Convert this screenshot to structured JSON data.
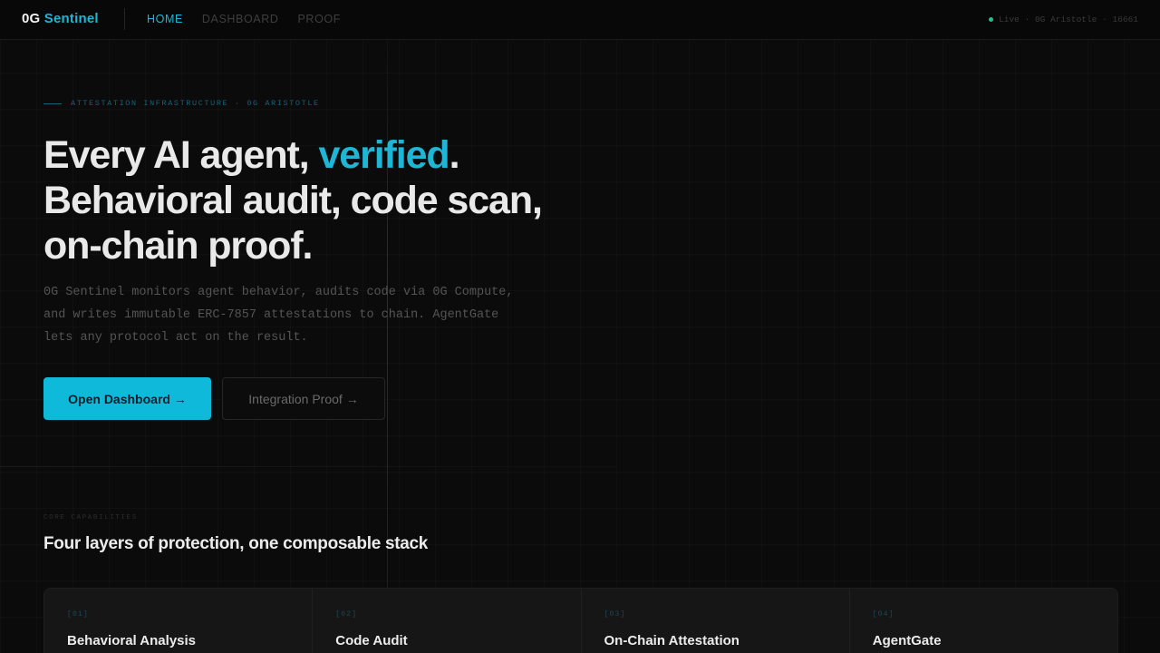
{
  "nav": {
    "brand_prefix": "0G",
    "brand_name": "Sentinel",
    "links": [
      {
        "label": "HOME"
      },
      {
        "label": "DASHBOARD"
      },
      {
        "label": "PROOF"
      }
    ],
    "status": "Live · 0G Aristotle · 16661"
  },
  "hero": {
    "eyebrow": "ATTESTATION INFRASTRUCTURE · 0G ARISTOTLE",
    "headline_line1_before": "Every AI agent, ",
    "headline_highlight": "verified",
    "headline_line1_after": ".",
    "headline_line2": "Behavioral audit, code scan,",
    "headline_line3": "on-chain proof.",
    "description": "0G Sentinel monitors agent behavior, audits code via 0G Compute, and writes immutable ERC-7857 attestations to chain. AgentGate lets any protocol act on the result.",
    "primary_button": "Open Dashboard →",
    "secondary_button": "Integration Proof →"
  },
  "capabilities": {
    "eyebrow": "CORE CAPABILITIES",
    "title": "Four layers of protection, one composable stack",
    "cards": [
      {
        "num": "[01]",
        "title": "Behavioral Analysis"
      },
      {
        "num": "[02]",
        "title": "Code Audit"
      },
      {
        "num": "[03]",
        "title": "On-Chain Attestation"
      },
      {
        "num": "[04]",
        "title": "AgentGate"
      }
    ]
  },
  "colors": {
    "accent": "#1fb6d6",
    "button": "#0fb9da",
    "background": "#0b0b0b",
    "status_dot": "#1ec28b"
  }
}
